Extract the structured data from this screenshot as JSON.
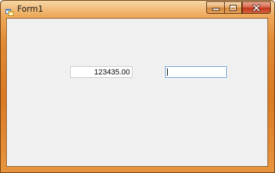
{
  "window": {
    "title": "Form1",
    "icon": "winforms-app-icon",
    "caption_buttons": [
      "minimize-icon",
      "maximize-icon",
      "close-icon"
    ]
  },
  "form": {
    "amount_value": "123435.00",
    "second_value": ""
  },
  "colors": {
    "frame_accent": "#e08a35",
    "client_background": "#f0f0f0",
    "focus_border": "#6e9fd6"
  }
}
